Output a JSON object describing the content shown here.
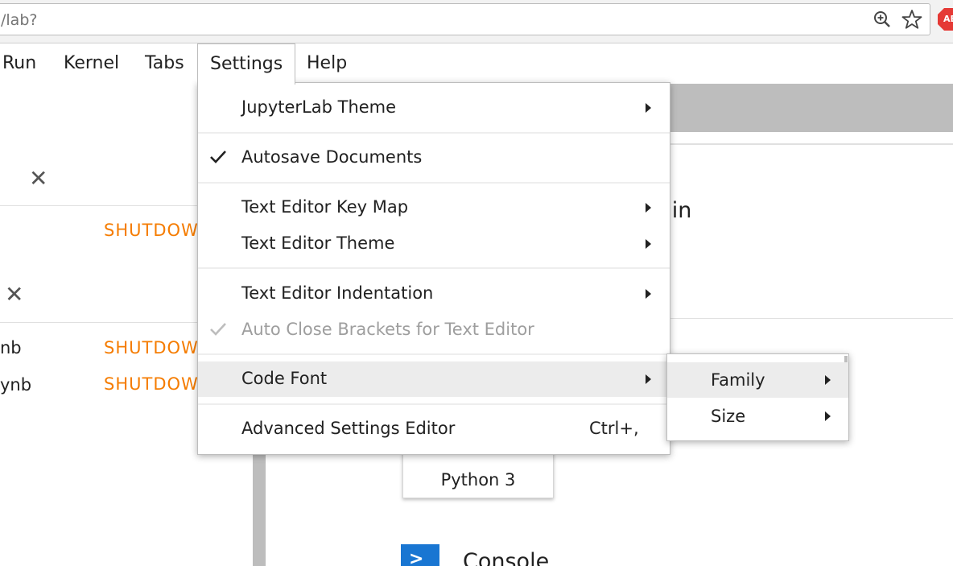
{
  "browser": {
    "url": "/lab?",
    "icons": [
      "zoom-icon",
      "star-icon",
      "adblock-icon"
    ],
    "adblock_label": "ABP"
  },
  "menubar": {
    "items": [
      {
        "label": "Run"
      },
      {
        "label": "Kernel"
      },
      {
        "label": "Tabs"
      },
      {
        "label": "Settings",
        "active": true
      },
      {
        "label": "Help"
      }
    ]
  },
  "left_panel": {
    "shutdown_label": "SHUTDOWN",
    "sessions": [
      {
        "name": "nb",
        "action": "SHUTDOWN"
      },
      {
        "name": "ynb",
        "action": "SHUTDOWN"
      }
    ]
  },
  "main": {
    "heading_fragment": "brain",
    "kernel_card_label": "Python 3",
    "console_label": "Console",
    "console_prompt": ">"
  },
  "settings_menu": {
    "items": [
      {
        "label": "JupyterLab Theme",
        "submenu": true
      },
      {
        "label": "Autosave Documents",
        "checked": true
      },
      {
        "label": "Text Editor Key Map",
        "submenu": true
      },
      {
        "label": "Text Editor Theme",
        "submenu": true
      },
      {
        "label": "Text Editor Indentation",
        "submenu": true
      },
      {
        "label": "Auto Close Brackets for Text Editor",
        "checked": true,
        "disabled": true
      },
      {
        "label": "Code Font",
        "submenu": true,
        "hover": true
      },
      {
        "label": "Advanced Settings Editor",
        "shortcut": "Ctrl+,"
      }
    ]
  },
  "code_font_submenu": {
    "items": [
      {
        "label": "Family",
        "submenu": true,
        "hover": true
      },
      {
        "label": "Size",
        "submenu": true
      }
    ]
  },
  "colors": {
    "accent_orange": "#f57c00",
    "console_blue": "#1976d2",
    "menu_hover": "#ececec",
    "adblock_red": "#e53935"
  }
}
